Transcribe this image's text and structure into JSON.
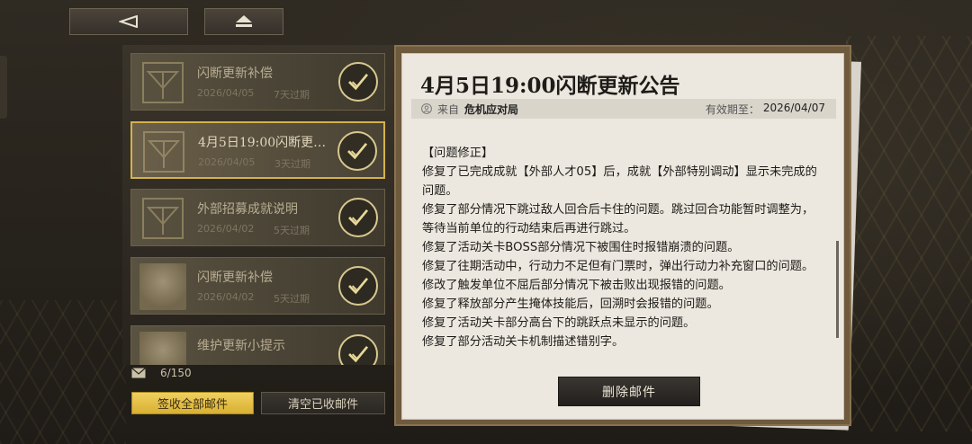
{
  "nav": {
    "back_icon": "back-triangle-icon",
    "home_icon": "eject-home-icon"
  },
  "mails": [
    {
      "title": "闪断更新补偿",
      "date": "2026/04/05",
      "expire": "7天过期",
      "thumb": "emblem-icon"
    },
    {
      "title": "4月5日19:00闪断更…",
      "date": "2026/04/05",
      "expire": "3天过期",
      "thumb": "emblem-icon"
    },
    {
      "title": "外部招募成就说明",
      "date": "2026/04/02",
      "expire": "5天过期",
      "thumb": "emblem-icon"
    },
    {
      "title": "闪断更新补偿",
      "date": "2026/04/02",
      "expire": "5天过期",
      "thumb": "avatar"
    },
    {
      "title": "维护更新小提示",
      "date": "",
      "expire": "",
      "thumb": "avatar"
    }
  ],
  "footer": {
    "count": "6/150",
    "claim_all": "签收全部邮件",
    "clear_read": "清空已收邮件"
  },
  "detail": {
    "title": "4月5日19:00闪断更新公告",
    "from_label": "来自",
    "sender": "危机应对局",
    "valid_label": "有效期至：",
    "valid_date": "2026/04/07",
    "body": [
      "【问题修正】",
      "修复了已完成成就【外部人才05】后，成就【外部特别调动】显示未完成的问题。",
      "修复了部分情况下跳过敌人回合后卡住的问题。跳过回合功能暂时调整为，等待当前单位的行动结束后再进行跳过。",
      "修复了活动关卡BOSS部分情况下被围住时报错崩溃的问题。",
      "修复了往期活动中，行动力不足但有门票时，弹出行动力补充窗口的问题。",
      "修改了触发单位不屈后部分情况下被击败出现报错的问题。",
      "修复了释放部分产生掩体技能后，回溯时会报错的问题。",
      "修复了活动关卡部分高台下的跳跃点未显示的问题。",
      "修复了部分活动关卡机制描述错别字。"
    ],
    "delete_label": "删除邮件"
  },
  "colors": {
    "accent": "#d4b24a",
    "claim": "#e8c44a"
  }
}
